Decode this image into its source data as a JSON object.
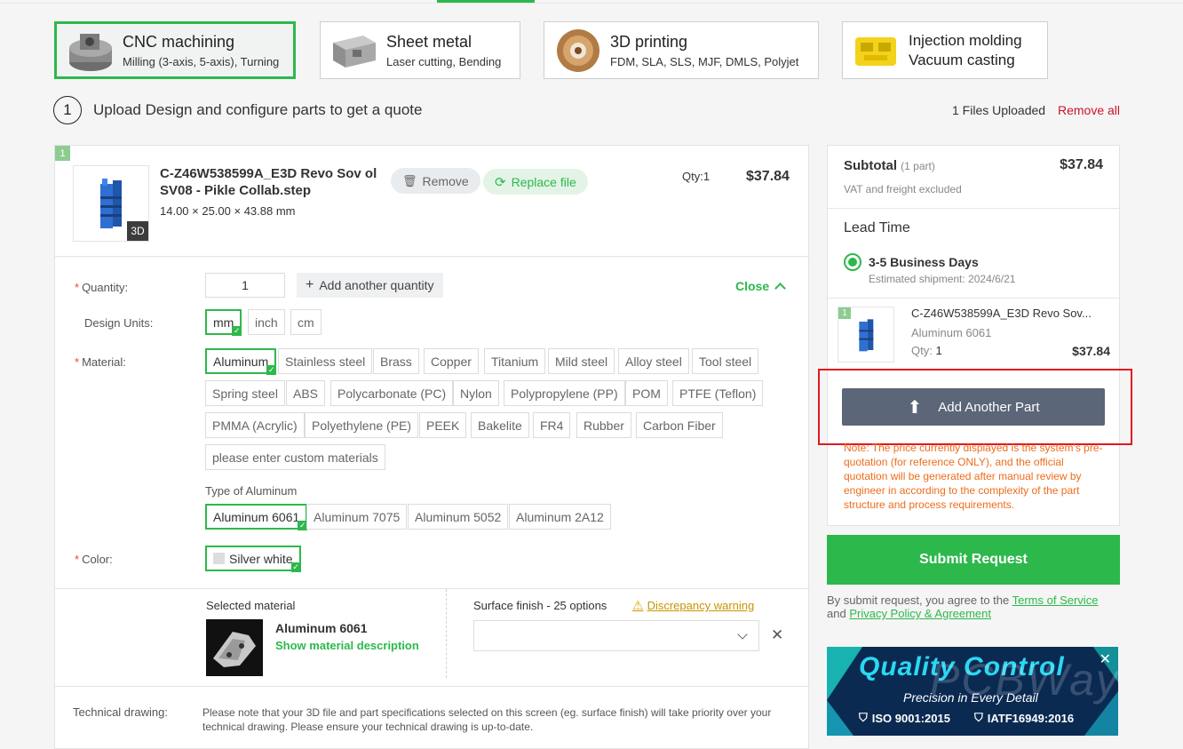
{
  "services": [
    {
      "title": "CNC machining",
      "subtitle": "Milling (3-axis, 5-axis), Turning",
      "icon": "cnc-part-icon"
    },
    {
      "title": "Sheet metal",
      "subtitle": "Laser cutting, Bending",
      "icon": "sheet-metal-icon"
    },
    {
      "title": "3D printing",
      "subtitle": "FDM, SLA, SLS, MJF, DMLS, Polyjet",
      "icon": "3d-print-icon"
    },
    {
      "title": "Injection molding",
      "subtitle": "Vacuum casting",
      "icon": "injection-mold-icon"
    }
  ],
  "step": {
    "number": "1",
    "text": "Upload Design and configure parts to get a quote"
  },
  "files": {
    "uploaded": "1 Files Uploaded",
    "remove_all": "Remove all"
  },
  "part": {
    "index": "1",
    "name": "C-Z46W538599A_E3D Revo Sov ol SV08 - Pikle Collab.step",
    "dims": "14.00 × 25.00 × 43.88 mm",
    "badge_3d": "3D",
    "remove": "Remove",
    "replace": "Replace file",
    "qty": "Qty:1",
    "price": "$37.84"
  },
  "config": {
    "quantity_label": "Quantity:",
    "quantity_value": "1",
    "add_quantity": "Add another quantity",
    "close": "Close",
    "units_label": "Design Units:",
    "units": [
      "mm",
      "inch",
      "cm"
    ],
    "material_label": "Material:",
    "materials_row1": [
      "Aluminum",
      "Stainless steel",
      "Brass",
      "Copper",
      "Titanium",
      "Mild steel",
      "Alloy steel",
      "Tool steel"
    ],
    "materials_row2": [
      "Spring steel",
      "ABS",
      "Polycarbonate (PC)",
      "Nylon",
      "Polypropylene (PP)",
      "POM",
      "PTFE (Teflon)"
    ],
    "materials_row3": [
      "PMMA (Acrylic)",
      "Polyethylene (PE)",
      "PEEK",
      "Bakelite",
      "FR4",
      "Rubber",
      "Carbon Fiber"
    ],
    "custom_material": "please enter custom materials",
    "type_label": "Type of Aluminum",
    "types": [
      "Aluminum 6061",
      "Aluminum 7075",
      "Aluminum 5052",
      "Aluminum 2A12"
    ],
    "color_label": "Color:",
    "color_value": "Silver white",
    "selected_material_label": "Selected material",
    "selected_material": "Aluminum 6061",
    "show_description": "Show material description",
    "surface_label": "Surface finish - 25 options",
    "discrepancy": "Discrepancy warning",
    "tech_label": "Technical drawing:",
    "tech_note": "Please note that your 3D file and part specifications selected on this screen (eg. surface finish) will take priority over your technical drawing. Please ensure your technical drawing is up-to-date."
  },
  "summary": {
    "subtotal_label": "Subtotal",
    "subtotal_parts": "(1 part)",
    "subtotal_price": "$37.84",
    "vat_note": "VAT and freight excluded",
    "lead_label": "Lead Time",
    "lead_option": "3-5 Business Days",
    "shipment": "Estimated shipment: 2024/6/21",
    "item_index": "1",
    "item_name": "C-Z46W538599A_E3D Revo Sov...",
    "item_material": "Aluminum 6061",
    "item_qty_label": "Qty:",
    "item_qty": "1",
    "item_price": "$37.84",
    "add_part": "Add Another Part",
    "note": "Note: The price currently displayed is the system's pre-quotation (for reference ONLY), and the official quotation will be generated after manual review by engineer in according to the complexity of the part structure and process requirements.",
    "submit": "Submit Request",
    "agree_pre": "By submit request, you agree to the",
    "terms": "Terms of Service",
    "and": "and",
    "privacy": "Privacy Policy & Agreement"
  },
  "banner": {
    "title": "Quality Control",
    "subtitle": "Precision in Every Detail",
    "cert1": "ISO 9001:2015",
    "cert2": "IATF16949:2016",
    "watermark": "PCBWay"
  },
  "colors": {
    "accent": "#2db84c",
    "danger": "#d0112b",
    "warning": "#ef6c1b",
    "button_dark": "#5b6678"
  }
}
